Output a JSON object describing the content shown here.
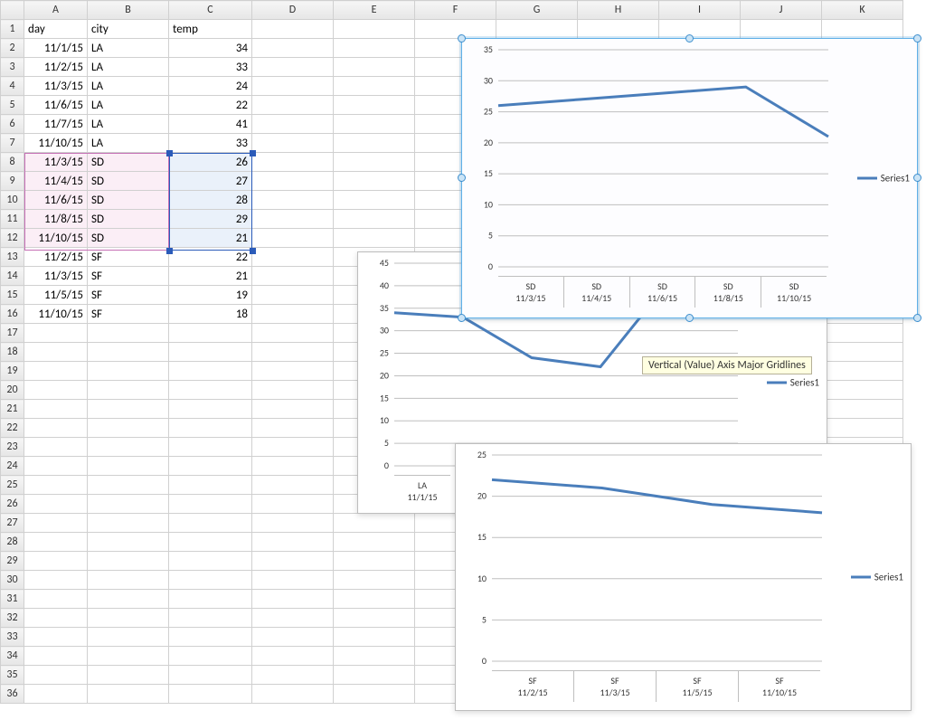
{
  "columns": [
    "",
    "A",
    "B",
    "C",
    "D",
    "E",
    "F",
    "G",
    "H",
    "I",
    "J",
    "K"
  ],
  "headers": {
    "A": "day",
    "B": "city",
    "C": "temp"
  },
  "rows": [
    {
      "r": 2,
      "day": "11/1/15",
      "city": "LA",
      "temp": 34
    },
    {
      "r": 3,
      "day": "11/2/15",
      "city": "LA",
      "temp": 33
    },
    {
      "r": 4,
      "day": "11/3/15",
      "city": "LA",
      "temp": 24
    },
    {
      "r": 5,
      "day": "11/6/15",
      "city": "LA",
      "temp": 22
    },
    {
      "r": 6,
      "day": "11/7/15",
      "city": "LA",
      "temp": 41
    },
    {
      "r": 7,
      "day": "11/10/15",
      "city": "LA",
      "temp": 33
    },
    {
      "r": 8,
      "day": "11/3/15",
      "city": "SD",
      "temp": 26
    },
    {
      "r": 9,
      "day": "11/4/15",
      "city": "SD",
      "temp": 27
    },
    {
      "r": 10,
      "day": "11/6/15",
      "city": "SD",
      "temp": 28
    },
    {
      "r": 11,
      "day": "11/8/15",
      "city": "SD",
      "temp": 29
    },
    {
      "r": 12,
      "day": "11/10/15",
      "city": "SD",
      "temp": 21
    },
    {
      "r": 13,
      "day": "11/2/15",
      "city": "SF",
      "temp": 22
    },
    {
      "r": 14,
      "day": "11/3/15",
      "city": "SF",
      "temp": 21
    },
    {
      "r": 15,
      "day": "11/5/15",
      "city": "SF",
      "temp": 19
    },
    {
      "r": 16,
      "day": "11/10/15",
      "city": "SF",
      "temp": 18
    }
  ],
  "total_rows": 36,
  "tooltip": "Vertical (Value) Axis Major Gridlines",
  "legend_label": "Series1",
  "chart_data": [
    {
      "type": "line",
      "id": "chart-sd",
      "selected": true,
      "categories": [
        "SD",
        "SD",
        "SD",
        "SD",
        "SD"
      ],
      "sub_categories": [
        "11/3/15",
        "11/4/15",
        "11/6/15",
        "11/8/15",
        "11/10/15"
      ],
      "series": [
        {
          "name": "Series1",
          "values": [
            26,
            27,
            28,
            29,
            21
          ]
        }
      ],
      "yticks": [
        0,
        5,
        10,
        15,
        20,
        25,
        30,
        35
      ],
      "ylim": [
        0,
        35
      ]
    },
    {
      "type": "line",
      "id": "chart-la",
      "selected": false,
      "categories": [
        "LA"
      ],
      "sub_categories": [
        "11/1/15"
      ],
      "series": [
        {
          "name": "Series1",
          "values": [
            34,
            33,
            24,
            22,
            41,
            33
          ]
        }
      ],
      "yticks": [
        0,
        5,
        10,
        15,
        20,
        25,
        30,
        35,
        40,
        45
      ],
      "ylim": [
        0,
        45
      ],
      "visible_category_count": 1
    },
    {
      "type": "line",
      "id": "chart-sf",
      "selected": false,
      "categories": [
        "SF",
        "SF",
        "SF",
        "SF"
      ],
      "sub_categories": [
        "11/2/15",
        "11/3/15",
        "11/5/15",
        "11/10/15"
      ],
      "series": [
        {
          "name": "Series1",
          "values": [
            22,
            21,
            19,
            18
          ]
        }
      ],
      "yticks": [
        0,
        5,
        10,
        15,
        20,
        25
      ],
      "ylim": [
        0,
        25
      ]
    }
  ]
}
